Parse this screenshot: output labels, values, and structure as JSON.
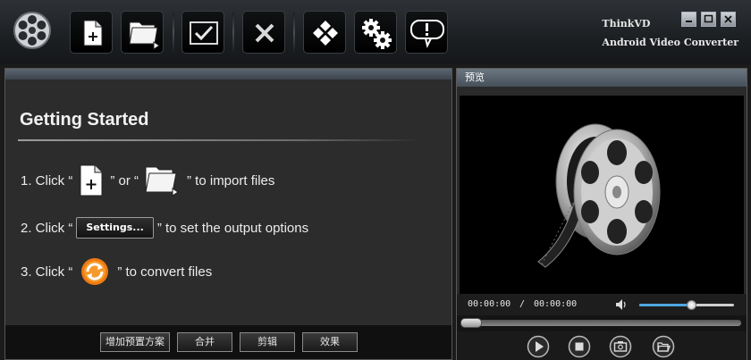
{
  "app": {
    "brand_line1": "ThinkVD",
    "brand_line2": "Android Video Converter"
  },
  "toolbar": {
    "buttons": [
      {
        "name": "add-file",
        "icon": "file-plus-icon"
      },
      {
        "name": "add-folder",
        "icon": "folder-icon"
      },
      {
        "name": "check",
        "icon": "checkbox-icon"
      },
      {
        "name": "remove",
        "icon": "x-icon"
      },
      {
        "name": "transform",
        "icon": "diamond-icon"
      },
      {
        "name": "settings",
        "icon": "gears-icon"
      },
      {
        "name": "help",
        "icon": "speech-bubble-icon"
      }
    ]
  },
  "getting_started": {
    "title": "Getting Started",
    "step1": {
      "prefix": "1. Click “",
      "middle": "” or “",
      "suffix": "” to import files"
    },
    "step2": {
      "prefix": "2. Click “",
      "chip": "Settings...",
      "suffix": "” to set the output options"
    },
    "step3": {
      "prefix": "3. Click “",
      "suffix": "” to convert files"
    }
  },
  "bottom_buttons": [
    "增加预置方案",
    "合并",
    "剪辑",
    "效果"
  ],
  "preview": {
    "title": "预览",
    "time_current": "00:00:00",
    "time_sep": "/",
    "time_total": "00:00:00",
    "volume": 0.55,
    "seek": 0.0
  },
  "colors": {
    "accent_blue": "#4fa8e0",
    "convert_orange": "#f07a10"
  }
}
